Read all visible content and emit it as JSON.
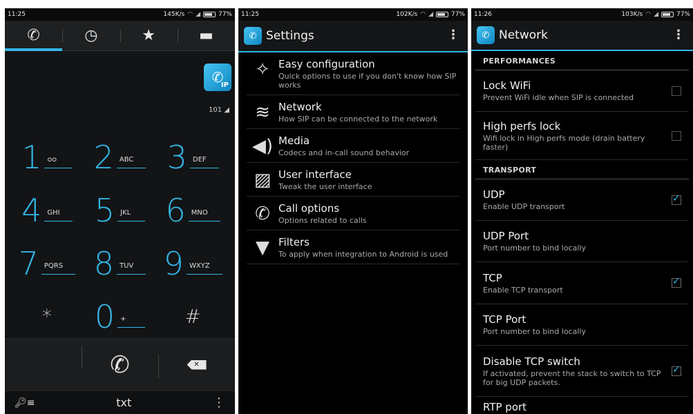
{
  "dialer": {
    "status": {
      "time": "11:25",
      "speed": "145K/s",
      "battery": "77%"
    },
    "tabs": [
      {
        "icon": "phone-icon",
        "glyph": "✆"
      },
      {
        "icon": "clock-icon",
        "glyph": "◷"
      },
      {
        "icon": "star-icon",
        "glyph": "★"
      },
      {
        "icon": "contacts-card-icon",
        "glyph": "▬"
      }
    ],
    "logo_text": "IP",
    "voicemail_number": "101",
    "keys": [
      {
        "digit": "1",
        "letters": "ᴑᴑ"
      },
      {
        "digit": "2",
        "letters": "ABC"
      },
      {
        "digit": "3",
        "letters": "DEF"
      },
      {
        "digit": "4",
        "letters": "GHI"
      },
      {
        "digit": "5",
        "letters": "JKL"
      },
      {
        "digit": "6",
        "letters": "MNO"
      },
      {
        "digit": "7",
        "letters": "PQRS"
      },
      {
        "digit": "8",
        "letters": "TUV"
      },
      {
        "digit": "9",
        "letters": "WXYZ"
      },
      {
        "digit": "*",
        "letters": ""
      },
      {
        "digit": "0",
        "letters": "+"
      },
      {
        "digit": "#",
        "letters": ""
      }
    ],
    "bottom": {
      "txt_label": "txt"
    }
  },
  "settings": {
    "status": {
      "time": "11:25",
      "speed": "102K/s",
      "battery": "77%"
    },
    "title": "Settings",
    "items": [
      {
        "icon": "magic-wand-icon",
        "glyph": "✧",
        "title": "Easy configuration",
        "subtitle": "Quick options to use if you don't know how SIP works"
      },
      {
        "icon": "wifi-icon",
        "glyph": "≋",
        "title": "Network",
        "subtitle": "How SIP can be connected to the network"
      },
      {
        "icon": "speaker-icon",
        "glyph": "◀)",
        "title": "Media",
        "subtitle": "Codecs and in-call sound behavior"
      },
      {
        "icon": "picture-icon",
        "glyph": "▨",
        "title": "User interface",
        "subtitle": "Tweak the user interface"
      },
      {
        "icon": "phone-icon",
        "glyph": "✆",
        "title": "Call options",
        "subtitle": "Options related to calls"
      },
      {
        "icon": "filter-icon",
        "glyph": "▼",
        "title": "Filters",
        "subtitle": "To apply when integration to Android is used"
      }
    ]
  },
  "network": {
    "status": {
      "time": "11:26",
      "speed": "103K/s",
      "battery": "77%"
    },
    "title": "Network",
    "sections": [
      {
        "category": "PERFORMANCES",
        "items": [
          {
            "title": "Lock WiFi",
            "subtitle": "Prevent WiFi idle when SIP is connected",
            "checked": false
          },
          {
            "title": "High perfs lock",
            "subtitle": "Wifi lock in High perfs mode (drain battery faster)",
            "checked": false
          }
        ]
      },
      {
        "category": "TRANSPORT",
        "items": [
          {
            "title": "UDP",
            "subtitle": "Enable UDP transport",
            "checked": true
          },
          {
            "title": "UDP Port",
            "subtitle": "Port number to bind locally",
            "checked": null
          },
          {
            "title": "TCP",
            "subtitle": "Enable TCP transport",
            "checked": true
          },
          {
            "title": "TCP Port",
            "subtitle": "Port number to bind locally",
            "checked": null
          },
          {
            "title": "Disable TCP switch",
            "subtitle": "If activated, prevent the stack to switch to TCP for big UDP packets.",
            "checked": true
          },
          {
            "title": "RTP port",
            "subtitle": "",
            "checked": null
          }
        ]
      }
    ]
  },
  "colors": {
    "accent": "#33b5e5",
    "background": "#000000"
  }
}
